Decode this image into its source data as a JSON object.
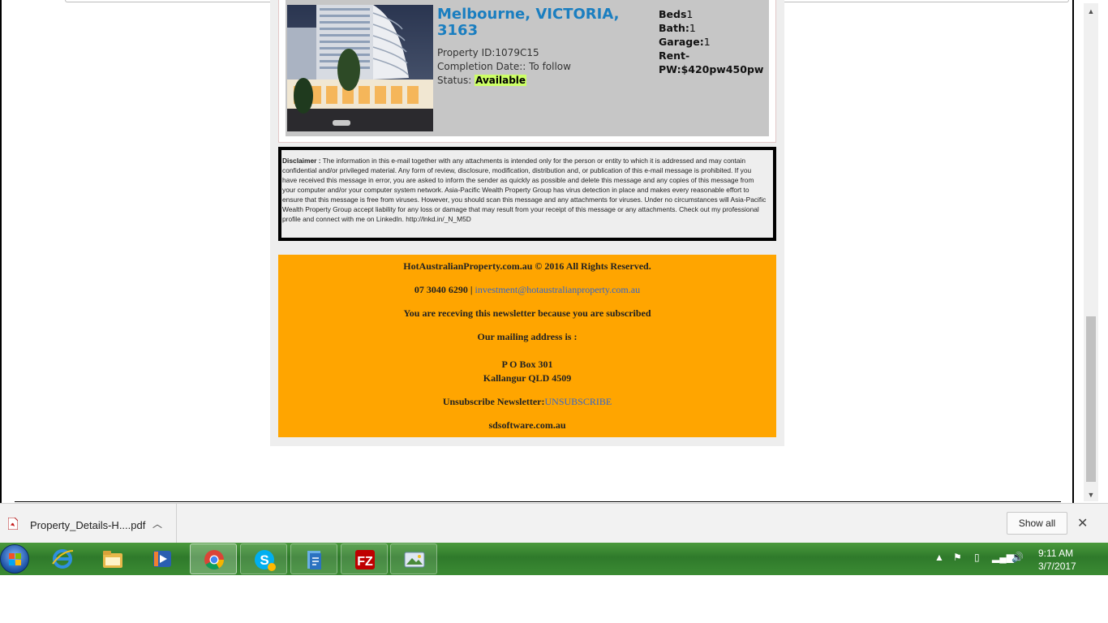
{
  "property": {
    "address_line1": "Melbourne, VICTORIA,",
    "address_line2": "3163",
    "property_id": "Property ID:1079C15",
    "completion": "Completion Date:: To follow",
    "status_label": "Status:",
    "status_value": "Available",
    "beds_label": "Beds",
    "beds_value": "1",
    "bath_label": "Bath:",
    "bath_value": "1",
    "garage_label": "Garage:",
    "garage_value": "1",
    "rent_label": "Rent-",
    "rent_value": "PW:$420pw450pw"
  },
  "disclaimer": {
    "label": "Disclaimer :",
    "text": "The information in this e-mail together with any attachments is intended only for the person or entity to which it is addressed and may contain confidential and/or privileged material. Any form of review, disclosure, modification, distribution and, or publication of this e-mail message is prohibited. If you have received this message in error, you are asked to inform the sender as quickly as possible and delete this message and any copies of this message from your computer and/or your computer system network. Asia-Pacific Wealth Property Group has virus detection in place and makes every reasonable effort to ensure that this message is free from viruses. However, you should scan this message and any attachments for viruses. Under no circumstances will Asia-Pacific Wealth Property Group accept liability for any loss or damage that may result from your receipt of this message or any attachments. Check out my professional profile and connect with me on LinkedIn. http://lnkd.in/_N_M5D"
  },
  "footer": {
    "copyright": "HotAustralianProperty.com.au © 2016 All Rights Reserved.",
    "phone": "07 3040 6290 |",
    "email": "investment@hotaustralianproperty.com.au",
    "subscribed": "You are receving this newsletter because you are subscribed",
    "mailing_heading": "Our mailing address is :",
    "address1": "P O Box 301",
    "address2": "Kallangur QLD 4509",
    "unsubscribe_label": "Unsubscribe Newsletter:",
    "unsubscribe_link": "UNSUBSCRIBE",
    "site": "sdsoftware.com.au"
  },
  "downloads": {
    "file_name": "Property_Details-H....pdf",
    "show_all": "Show all"
  },
  "taskbar": {
    "apps": [
      "internet-explorer-icon",
      "windows-explorer-icon",
      "media-player-icon",
      "chrome-icon",
      "skype-icon",
      "app-icon",
      "filezilla-icon",
      "photo-viewer-icon"
    ],
    "time": "9:11 AM",
    "date": "3/7/2017"
  },
  "colors": {
    "address_blue": "#1a7ec0",
    "footer_orange": "#ffa500",
    "status_green": "#ccff66",
    "link_blue": "#3366cc",
    "taskbar_green": "#2f7a2b"
  }
}
